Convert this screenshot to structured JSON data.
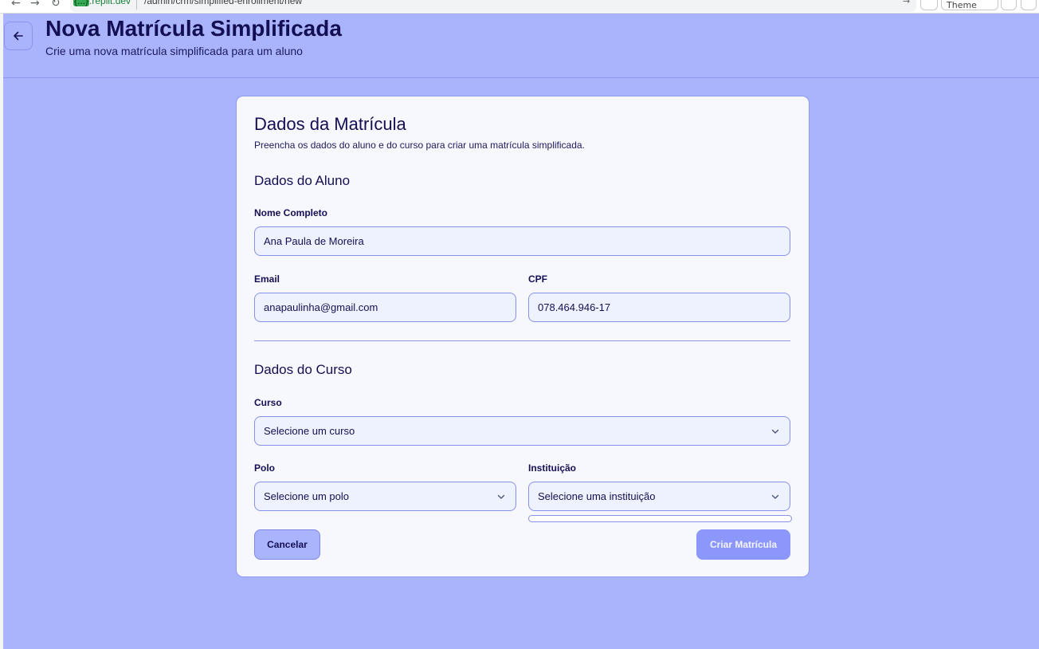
{
  "browser": {
    "url_host_highlight": "{...}",
    "url_host": ".replit.dev",
    "url_path": "/admin/crm/simplified-enrollment/new",
    "theme_label": "Theme"
  },
  "header": {
    "title": "Nova Matrícula Simplificada",
    "subtitle": "Crie uma nova matrícula simplificada para um aluno"
  },
  "form": {
    "title": "Dados da Matrícula",
    "description": "Preencha os dados do aluno e do curso para criar uma matrícula simplificada.",
    "student_section": {
      "title": "Dados do Aluno",
      "name_label": "Nome Completo",
      "name_value": "Ana Paula de Moreira",
      "email_label": "Email",
      "email_value": "anapaulinha@gmail.com",
      "cpf_label": "CPF",
      "cpf_value": "078.464.946-17"
    },
    "course_section": {
      "title": "Dados do Curso",
      "course_label": "Curso",
      "course_placeholder": "Selecione um curso",
      "polo_label": "Polo",
      "polo_placeholder": "Selecione um polo",
      "institution_label": "Instituição",
      "institution_placeholder": "Selecione uma instituição"
    },
    "cancel_label": "Cancelar",
    "submit_label": "Criar Matrícula"
  },
  "colors": {
    "page_background": "#a9b4fd",
    "card_background": "#f7f8fe",
    "text_primary": "#140f52",
    "input_border": "#8790ea",
    "submit_button": "#8c97fb"
  },
  "icons": {
    "back": "arrow-left-icon",
    "select": "chevron-down-icon"
  }
}
